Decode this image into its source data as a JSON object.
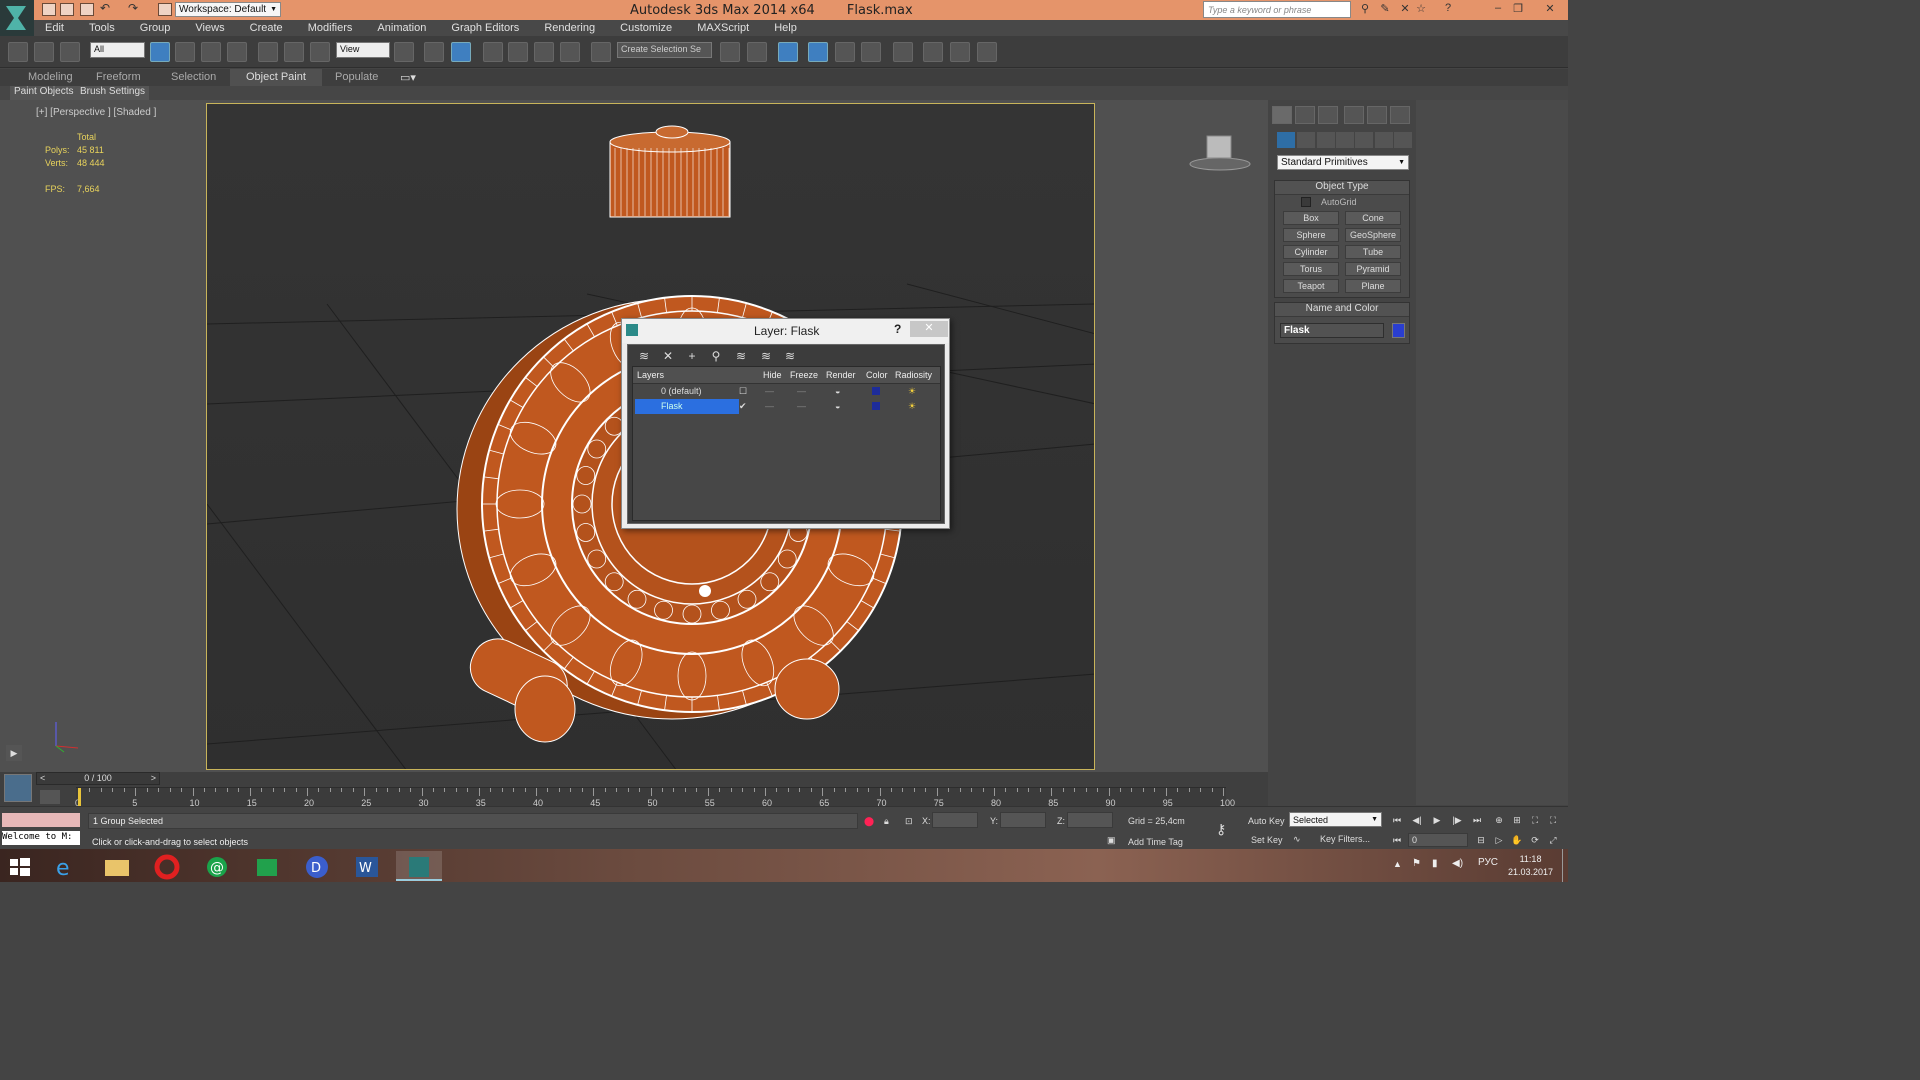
{
  "titlebar": {
    "app_title": "Autodesk 3ds Max  2014 x64",
    "file_name": "Flask.max",
    "workspace": "Workspace: Default",
    "search_placeholder": "Type a keyword or phrase"
  },
  "menu": [
    "Edit",
    "Tools",
    "Group",
    "Views",
    "Create",
    "Modifiers",
    "Animation",
    "Graph Editors",
    "Rendering",
    "Customize",
    "MAXScript",
    "Help"
  ],
  "toolbar": {
    "selection_filter": "All",
    "ref_coord": "View",
    "named_selection": "Create Selection Se"
  },
  "ribbon": {
    "tabs": [
      "Modeling",
      "Freeform",
      "Selection",
      "Object Paint",
      "Populate"
    ],
    "active_tab": "Object Paint",
    "sub_items": [
      "Paint Objects",
      "Brush Settings"
    ]
  },
  "viewport": {
    "label": "[+] [Perspective ] [Shaded ]",
    "stats": {
      "total_label": "Total",
      "polys_label": "Polys:",
      "polys": "45 811",
      "verts_label": "Verts:",
      "verts": "48 444",
      "fps_label": "FPS:",
      "fps": "7,664"
    },
    "object_color": "#c0581f",
    "wire_color": "#ffffff"
  },
  "command_panel": {
    "category": "Standard Primitives",
    "object_type_title": "Object Type",
    "autogrid": "AutoGrid",
    "primitives": [
      "Box",
      "Cone",
      "Sphere",
      "GeoSphere",
      "Cylinder",
      "Tube",
      "Torus",
      "Pyramid",
      "Teapot",
      "Plane"
    ],
    "name_color_title": "Name and Color",
    "object_name": "Flask",
    "object_swatch": "#2a3ed0"
  },
  "layer_dialog": {
    "title": "Layer: Flask",
    "help": "?",
    "close": "✕",
    "columns": [
      "Layers",
      "Hide",
      "Freeze",
      "Render",
      "Color",
      "Radiosity"
    ],
    "rows": [
      {
        "name": "0 (default)",
        "selected": false,
        "check": "☐"
      },
      {
        "name": "Flask",
        "selected": true,
        "check": "✔"
      }
    ]
  },
  "timeline": {
    "position": "0 / 100",
    "ticks": [
      "0",
      "5",
      "10",
      "15",
      "20",
      "25",
      "30",
      "35",
      "40",
      "45",
      "50",
      "55",
      "60",
      "65",
      "70",
      "75",
      "80",
      "85",
      "90",
      "95",
      "100"
    ]
  },
  "status": {
    "listener_text": "Welcome to M:",
    "selection": "1 Group Selected",
    "prompt": "Click or click-and-drag to select objects",
    "x_label": "X:",
    "y_label": "Y:",
    "z_label": "Z:",
    "grid": "Grid = 25,4cm",
    "add_time_tag": "Add Time Tag",
    "auto_key": "Auto Key",
    "set_key": "Set Key",
    "key_mode": "Selected",
    "key_filters": "Key Filters...",
    "frame": "0"
  },
  "taskbar": {
    "tray_lang": "РУС",
    "time": "11:18",
    "date": "21.03.2017"
  }
}
